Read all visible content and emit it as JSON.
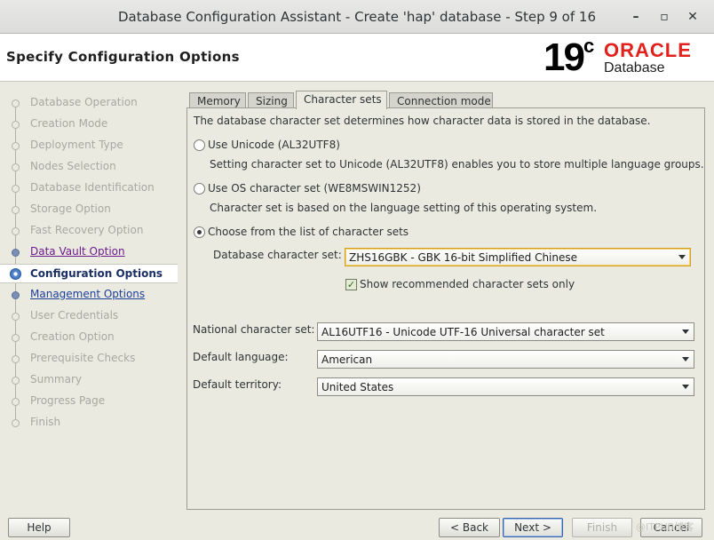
{
  "window": {
    "title": "Database Configuration Assistant - Create 'hap' database - Step 9 of 16"
  },
  "header": {
    "page_title": "Specify Configuration Options",
    "logo_version": "19",
    "logo_version_sup": "c",
    "logo_brand": "ORACLE",
    "logo_product": "Database",
    "logo_brand_color": "#e2211c"
  },
  "steps": [
    {
      "label": "Database Operation",
      "state": "disabled"
    },
    {
      "label": "Creation Mode",
      "state": "disabled"
    },
    {
      "label": "Deployment Type",
      "state": "disabled"
    },
    {
      "label": "Nodes Selection",
      "state": "disabled"
    },
    {
      "label": "Database Identification",
      "state": "disabled"
    },
    {
      "label": "Storage Option",
      "state": "disabled"
    },
    {
      "label": "Fast Recovery Option",
      "state": "disabled"
    },
    {
      "label": "Data Vault Option",
      "state": "visited"
    },
    {
      "label": "Configuration Options",
      "state": "current"
    },
    {
      "label": "Management Options",
      "state": "visited"
    },
    {
      "label": "User Credentials",
      "state": "disabled"
    },
    {
      "label": "Creation Option",
      "state": "disabled"
    },
    {
      "label": "Prerequisite Checks",
      "state": "disabled"
    },
    {
      "label": "Summary",
      "state": "disabled"
    },
    {
      "label": "Progress Page",
      "state": "disabled"
    },
    {
      "label": "Finish",
      "state": "disabled"
    }
  ],
  "tabs": [
    {
      "label": "Memory",
      "active": false
    },
    {
      "label": "Sizing",
      "active": false
    },
    {
      "label": "Character sets",
      "active": true
    },
    {
      "label": "Connection mode",
      "active": false
    }
  ],
  "charset": {
    "intro": "The database character set determines how character data is stored in the database.",
    "opt_unicode_label": "Use Unicode (AL32UTF8)",
    "opt_unicode_desc": "Setting character set to Unicode (AL32UTF8) enables you to store multiple language groups.",
    "opt_os_label": "Use OS character set (WE8MSWIN1252)",
    "opt_os_desc": "Character set is based on the language setting of this operating system.",
    "opt_list_label": "Choose from the list of character sets",
    "selected_option": "list",
    "db_charset_label": "Database character set:",
    "db_charset_value": "ZHS16GBK - GBK 16-bit Simplified Chinese",
    "show_recommended_label": "Show recommended character sets only",
    "show_recommended_checked": true,
    "national_label": "National character set:",
    "national_value": "AL16UTF16 - Unicode UTF-16 Universal character set",
    "language_label": "Default language:",
    "language_value": "American",
    "territory_label": "Default territory:",
    "territory_value": "United States"
  },
  "footer": {
    "help": "Help",
    "back": "< Back",
    "next": "Next >",
    "finish": "Finish",
    "cancel": "Cancel",
    "watermark": "@ITPUB博客"
  }
}
